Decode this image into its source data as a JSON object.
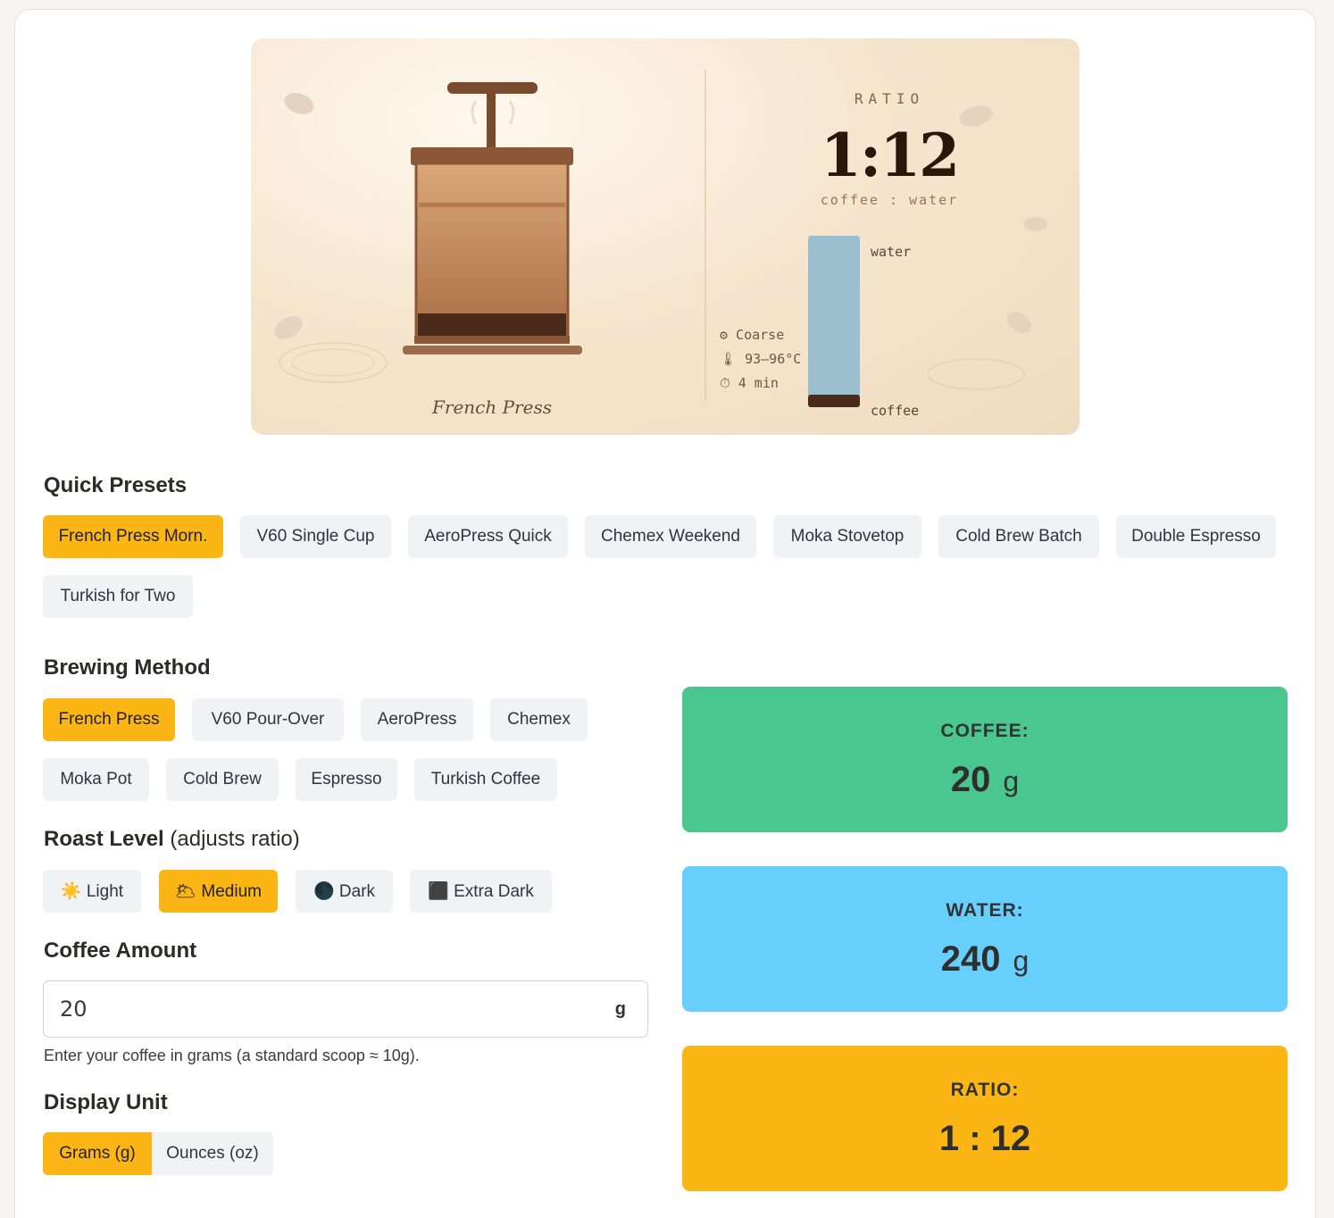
{
  "hero": {
    "ratio_label": "RATIO",
    "ratio_value": "1:12",
    "ratio_sub": "coffee : water",
    "water_label": "water",
    "coffee_label": "coffee",
    "grind": "⚙ Coarse",
    "temperature": "🌡 93–96°C",
    "time": "⏱ 4 min",
    "method_name": "French Press"
  },
  "presets": {
    "title": "Quick Presets",
    "items": [
      "French Press Morn.",
      "V60 Single Cup",
      "AeroPress Quick",
      "Chemex Weekend",
      "Moka Stovetop",
      "Cold Brew Batch",
      "Double Espresso",
      "Turkish for Two"
    ],
    "active_index": 0
  },
  "methods": {
    "title": "Brewing Method",
    "items": [
      "French Press",
      "V60 Pour-Over",
      "AeroPress",
      "Chemex",
      "Moka Pot",
      "Cold Brew",
      "Espresso",
      "Turkish Coffee"
    ],
    "active_index": 0
  },
  "roast": {
    "title": "Roast Level",
    "subtitle": "(adjusts ratio)",
    "items": [
      "☀️ Light",
      "🌥 Medium",
      "🌑 Dark",
      "⬛ Extra Dark"
    ],
    "active_index": 1
  },
  "amount": {
    "title": "Coffee Amount",
    "value": "20",
    "unit": "g",
    "helper": "Enter your coffee in grams (a standard scoop ≈ 10g)."
  },
  "display_unit": {
    "title": "Display Unit",
    "items": [
      "Grams (g)",
      "Ounces (oz)"
    ],
    "active_index": 0
  },
  "results": {
    "coffee": {
      "label": "COFFEE:",
      "value": "20",
      "unit": "g",
      "color": "#49c78f"
    },
    "water": {
      "label": "WATER:",
      "value": "240",
      "unit": "g",
      "color": "#66cffc"
    },
    "ratio": {
      "label": "RATIO:",
      "value": "1 : 12",
      "color": "#fbb515"
    }
  },
  "colors": {
    "accent": "#fbb515",
    "chip_bg": "#f1f2f4",
    "water_bar": "#9bbfcf",
    "coffee_bar": "#4a2a1a"
  }
}
